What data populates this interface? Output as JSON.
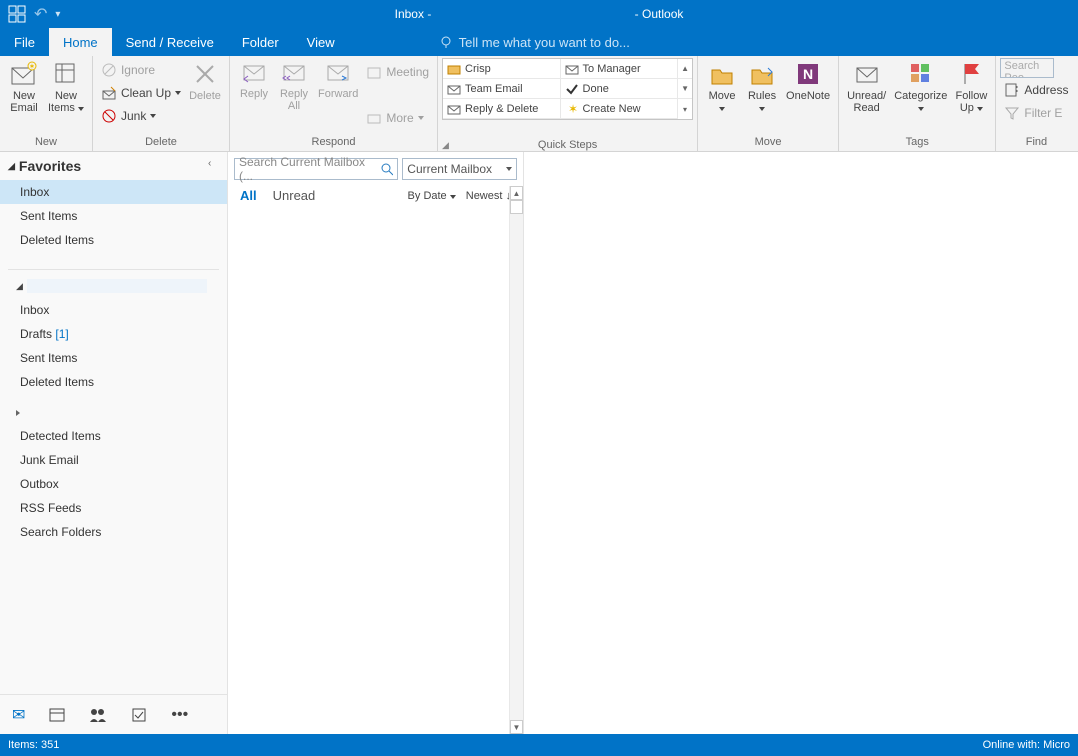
{
  "titlebar": {
    "title": "Inbox -                                                             - Outlook"
  },
  "tabs": {
    "file": "File",
    "home": "Home",
    "sendreceive": "Send / Receive",
    "folder": "Folder",
    "view": "View",
    "tellme": "Tell me what you want to do..."
  },
  "ribbon": {
    "new": {
      "label": "New",
      "email": "New\nEmail",
      "items": "New\nItems"
    },
    "delete_grp": {
      "label": "Delete",
      "ignore": "Ignore",
      "cleanup": "Clean Up",
      "junk": "Junk",
      "delete": "Delete"
    },
    "respond": {
      "label": "Respond",
      "reply": "Reply",
      "replyall": "Reply\nAll",
      "forward": "Forward",
      "meeting": "Meeting",
      "more": "More"
    },
    "quicksteps": {
      "label": "Quick Steps",
      "crisp": "Crisp",
      "tomanager": "To Manager",
      "teamemail": "Team Email",
      "done": "Done",
      "replydelete": "Reply & Delete",
      "createnew": "Create New"
    },
    "move_grp": {
      "label": "Move",
      "move": "Move",
      "rules": "Rules",
      "onenote": "OneNote"
    },
    "tags": {
      "label": "Tags",
      "unread": "Unread/\nRead",
      "categorize": "Categorize",
      "followup": "Follow\nUp"
    },
    "find": {
      "label": "Find",
      "search": "Search Peo",
      "address": "Address",
      "filter": "Filter E"
    }
  },
  "nav": {
    "favorites": "Favorites",
    "fav_items": [
      "Inbox",
      "Sent Items",
      "Deleted Items"
    ],
    "folders": [
      "Inbox",
      "Drafts",
      "Sent Items",
      "Deleted Items"
    ],
    "drafts_count": "[1]",
    "folders2": [
      "Detected Items",
      "Junk Email",
      "Outbox",
      "RSS Feeds",
      "Search Folders"
    ]
  },
  "list": {
    "search_placeholder": "Search Current Mailbox (...",
    "scope": "Current Mailbox",
    "all": "All",
    "unread": "Unread",
    "bydate": "By Date",
    "newest": "Newest"
  },
  "status": {
    "items": "Items: 351",
    "online": "Online with: Micro"
  }
}
